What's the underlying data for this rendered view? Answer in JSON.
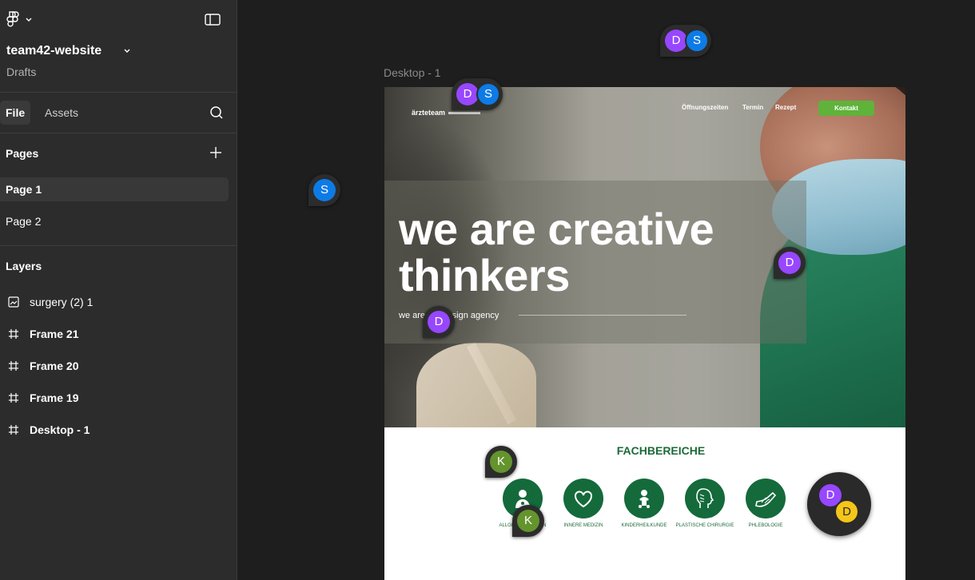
{
  "sidebar": {
    "project_name": "team42-website",
    "location": "Drafts",
    "tabs": [
      {
        "label": "File"
      },
      {
        "label": "Assets"
      }
    ],
    "pages_title": "Pages",
    "pages": [
      {
        "label": "Page 1",
        "selected": true
      },
      {
        "label": "Page 2",
        "selected": false
      }
    ],
    "layers_title": "Layers",
    "layers": [
      {
        "label": "surgery (2) 1",
        "icon": "image-icon"
      },
      {
        "label": "Frame 21",
        "icon": "frame-icon"
      },
      {
        "label": "Frame 20",
        "icon": "frame-icon"
      },
      {
        "label": "Frame 19",
        "icon": "frame-icon"
      },
      {
        "label": "Desktop - 1",
        "icon": "frame-icon"
      }
    ]
  },
  "canvas": {
    "frame_label": "Desktop - 1",
    "collaborators": {
      "top_pill": [
        "D",
        "S"
      ],
      "frame_pill": [
        "D",
        "S"
      ],
      "left_pin": "S",
      "hero_pin": "D",
      "subline_pin": "D",
      "section_pin": "K",
      "icon_pin": "K",
      "cluster": [
        "D",
        "D"
      ]
    },
    "colors": {
      "purple": "#9747ff",
      "blue": "#0d7be6",
      "green": "#64942d",
      "yellow": "#f5c518"
    }
  },
  "website": {
    "brand": "ärzteteam",
    "nav": [
      "Öffnungszeiten",
      "Termin",
      "Rezept"
    ],
    "cta": "Kontakt",
    "headline_line1": "we are creative",
    "headline_line2": "thinkers",
    "subline": "we are the design agency",
    "section_title": "FACHBEREICHE",
    "services": [
      {
        "label": "ALLGEMEINMEDIZIN",
        "icon": "doctor-icon"
      },
      {
        "label": "INNERE MEDIZIN",
        "icon": "heart-icon"
      },
      {
        "label": "KINDERHEILKUNDE",
        "icon": "baby-icon"
      },
      {
        "label": "PLASTISCHE CHIRURGIE",
        "icon": "face-profile-icon"
      },
      {
        "label": "PHLEBOLOGIE",
        "icon": "leg-icon"
      }
    ],
    "accent_green": "#146a3b",
    "cta_color": "#5fb23a"
  }
}
